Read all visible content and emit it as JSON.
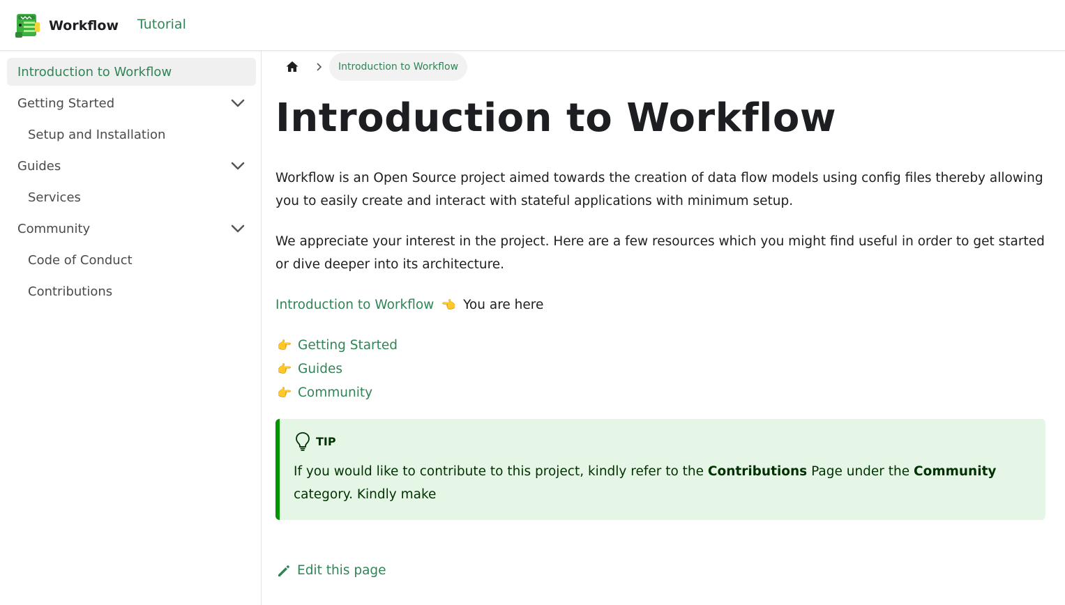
{
  "navbar": {
    "brand_title": "Workflow",
    "nav_link": "Tutorial"
  },
  "sidebar": {
    "items": [
      {
        "label": "Introduction to Workflow",
        "active": true
      },
      {
        "label": "Getting Started",
        "collapsible": true
      },
      {
        "label": "Setup and Installation",
        "child": true
      },
      {
        "label": "Guides",
        "collapsible": true
      },
      {
        "label": "Services",
        "child": true
      },
      {
        "label": "Community",
        "collapsible": true
      },
      {
        "label": "Code of Conduct",
        "child": true
      },
      {
        "label": "Contributions",
        "child": true
      }
    ]
  },
  "breadcrumbs": {
    "separator": "›",
    "current": "Introduction to Workflow"
  },
  "content": {
    "title": "Introduction to Workflow",
    "paragraph1": "Workflow is an Open Source project aimed towards the creation of data flow models using config files thereby allowing you to easily create and interact with stateful applications with minimum setup.",
    "paragraph2": "We appreciate your interest in the project. Here are a few resources which you might find useful in order to get started or dive deeper into its architecture.",
    "here_link": "Introduction to Workflow",
    "here_emoji": "👈",
    "here_text": "You are here",
    "resource_emoji": "👉",
    "resources": [
      "Getting Started",
      "Guides",
      "Community"
    ]
  },
  "tip": {
    "heading": "TIP",
    "text_before": "If you would like to contribute to this project, kindly refer to the ",
    "bold1": "Contributions",
    "text_middle": " Page under the ",
    "bold2": "Community",
    "text_after": " category. Kindly make"
  },
  "footer": {
    "edit_label": "Edit this page"
  },
  "colors": {
    "accent": "#2e8555",
    "tip_background": "#e6f6e6",
    "tip_border": "#009400"
  }
}
